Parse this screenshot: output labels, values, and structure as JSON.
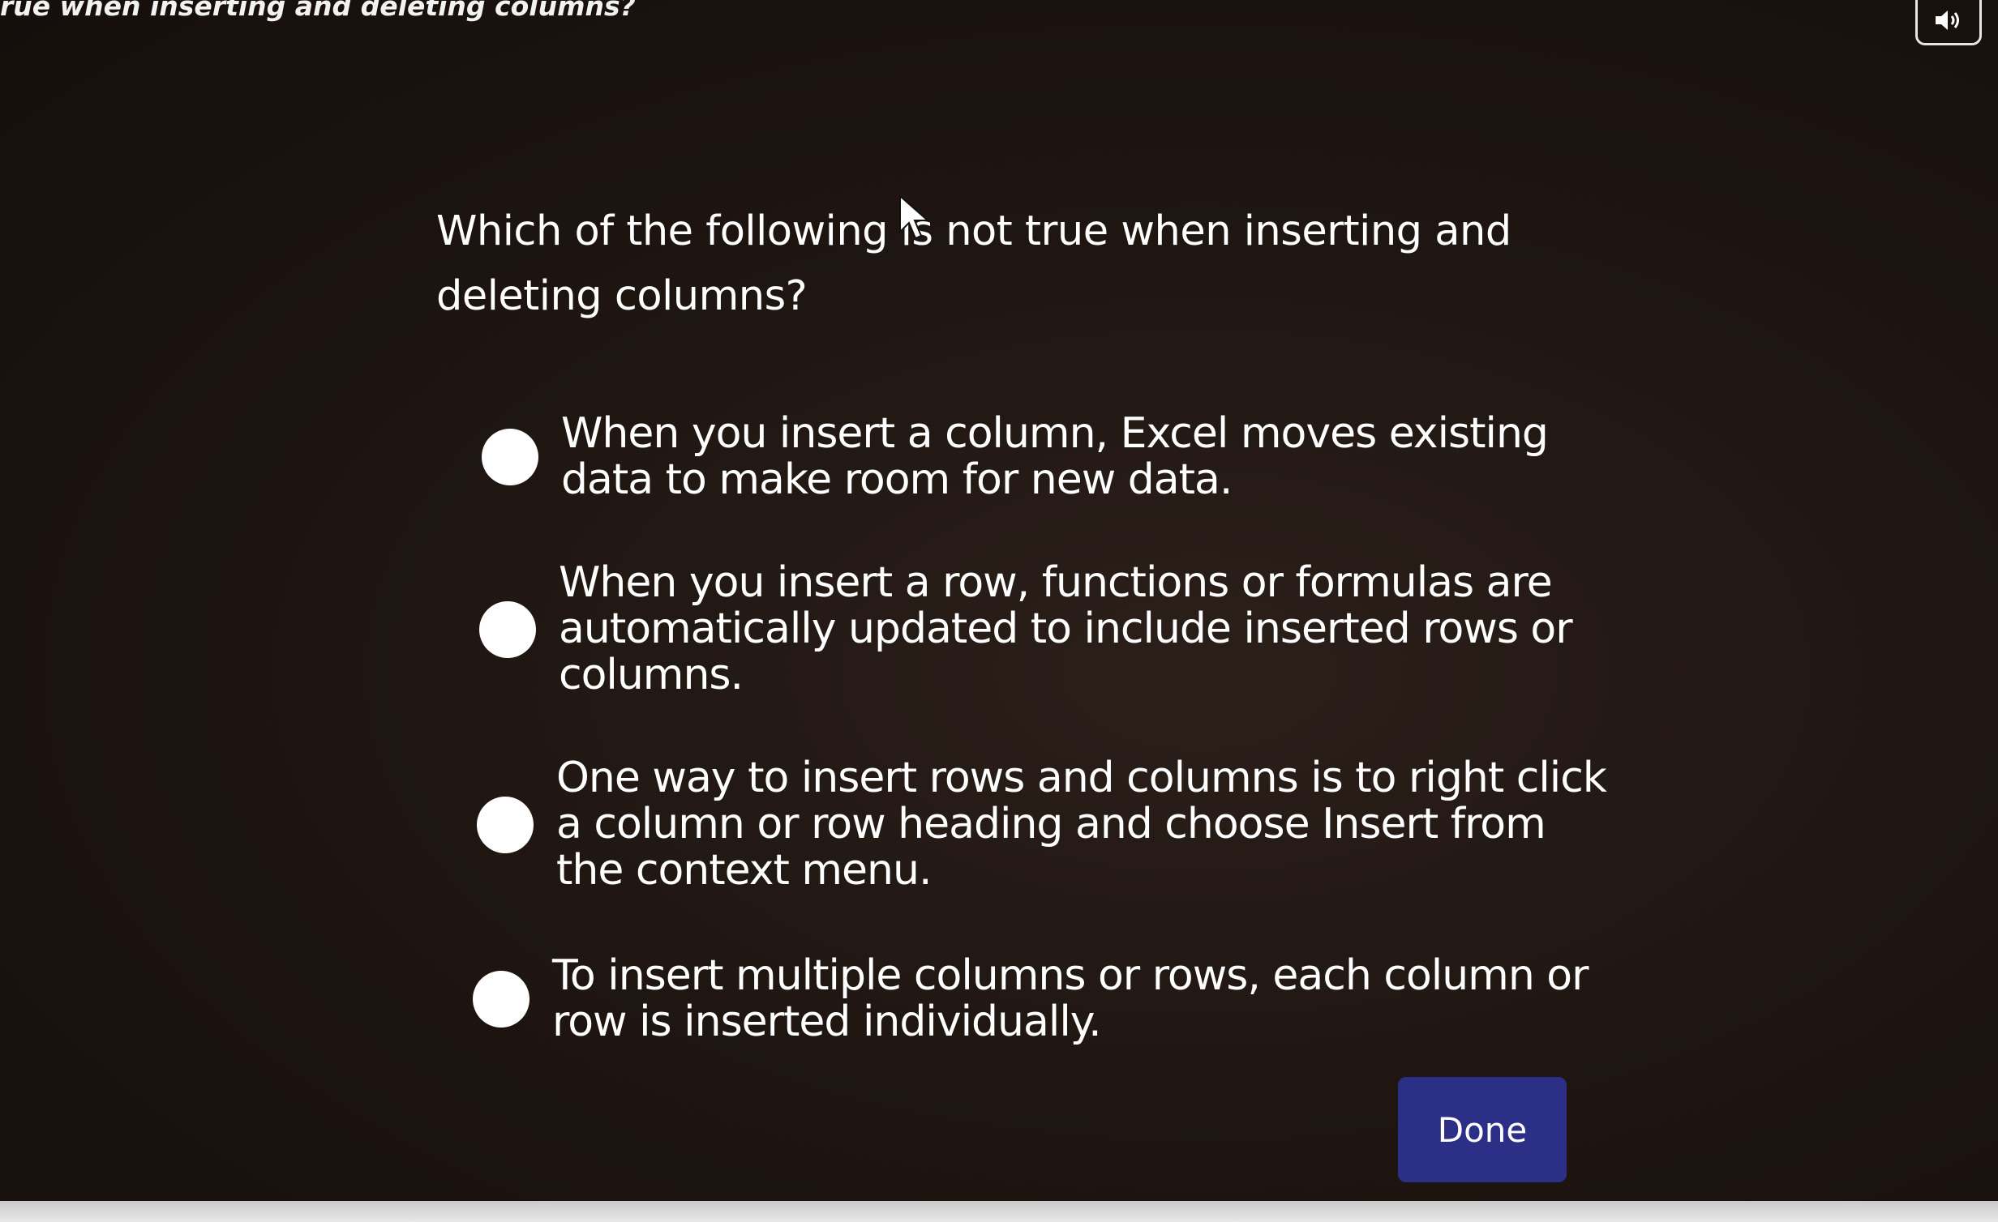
{
  "header": {
    "title": "rue when inserting and deleting columns?",
    "audio_icon": "speaker-icon"
  },
  "question": {
    "text": "Which of the following is not true when inserting and deleting columns?"
  },
  "options": [
    {
      "label": "When you insert a column, Excel moves existing data to make room for new data."
    },
    {
      "label": "When you insert a row, functions or formulas are automatically updated to include inserted rows or columns."
    },
    {
      "label": "One way to insert rows and columns is to right click a column or row heading and choose Insert from the context menu."
    },
    {
      "label": "To insert multiple columns or rows, each column or row is inserted individually."
    }
  ],
  "footer": {
    "done_label": "Done"
  },
  "colors": {
    "background": "#1f1612",
    "button": "#2c2f86",
    "text": "#ffffff"
  }
}
